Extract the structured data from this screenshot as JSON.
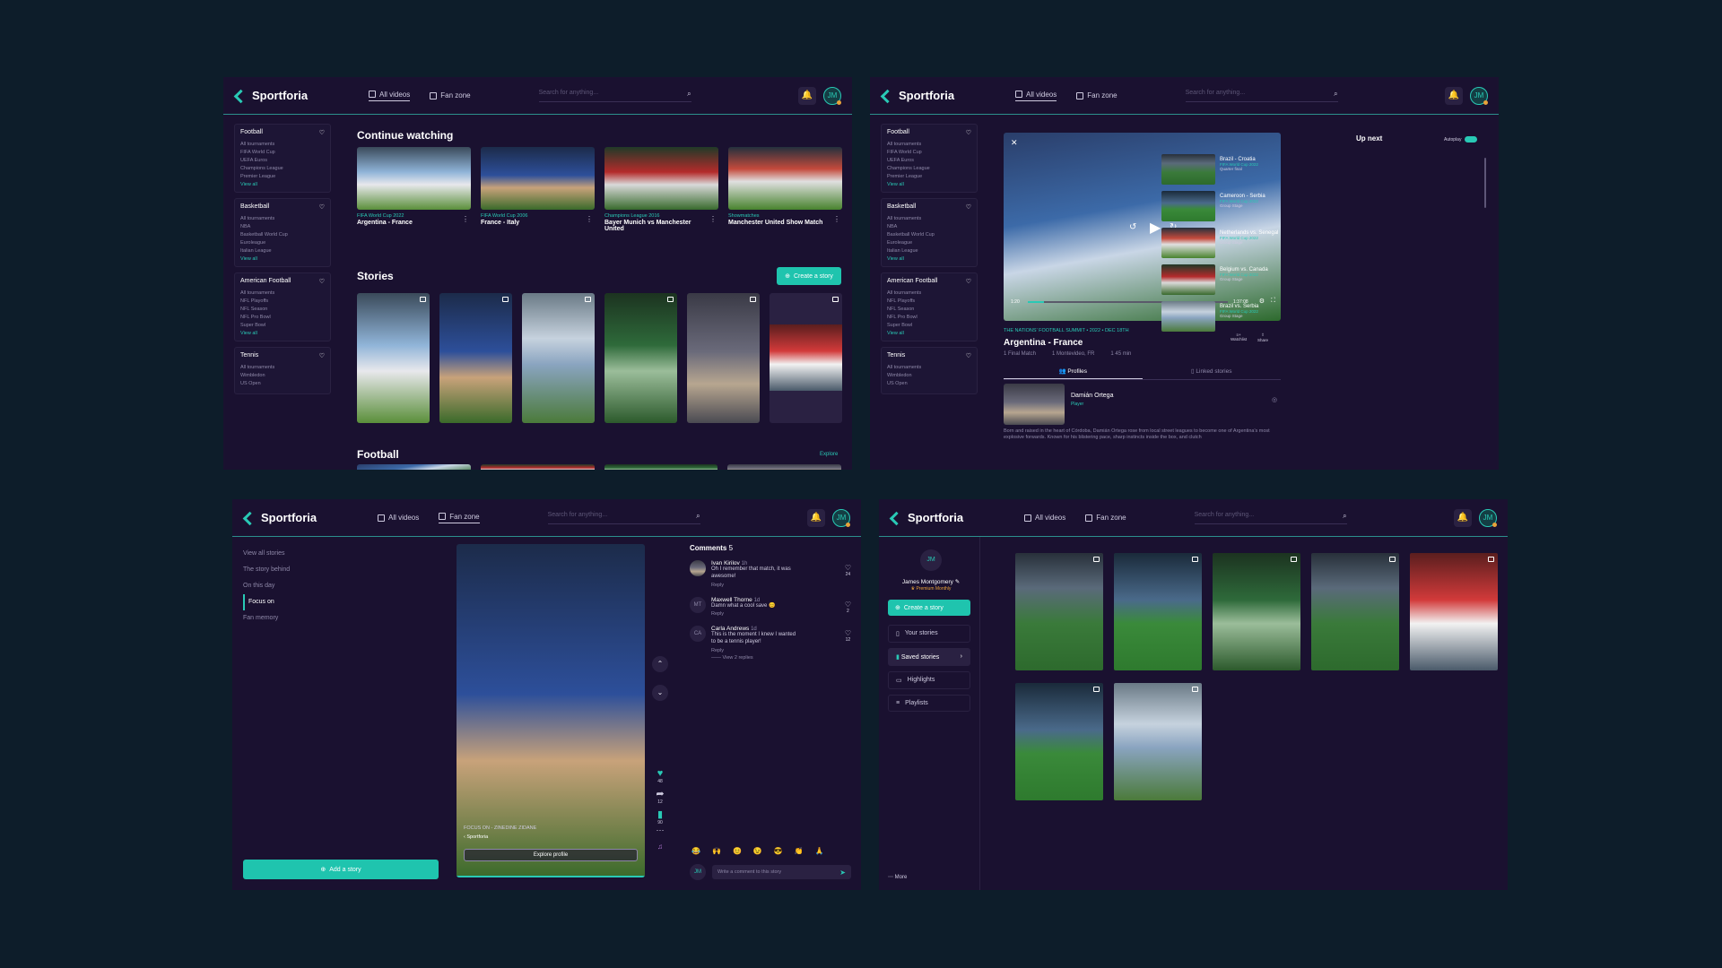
{
  "brand": "Sportforia",
  "nav": {
    "all_videos": "All videos",
    "fan_zone": "Fan zone"
  },
  "search_placeholder": "Search for anything...",
  "user_initials": "JM",
  "sidebar": [
    {
      "title": "Football",
      "items": [
        "All tournaments",
        "FIFA World Cup",
        "UEFA Euros",
        "Champions League",
        "Premier League"
      ]
    },
    {
      "title": "Basketball",
      "items": [
        "All tournaments",
        "NBA",
        "Basketball World Cup",
        "Euroleague",
        "Italian League"
      ]
    },
    {
      "title": "American Football",
      "items": [
        "All tournaments",
        "NFL Playoffs",
        "NFL Season",
        "NFL Pro Bowl",
        "Super Bowl"
      ]
    },
    {
      "title": "Tennis",
      "items": [
        "All tournaments",
        "Wimbledon",
        "US Open"
      ]
    }
  ],
  "view_all": "View all",
  "home": {
    "continue_title": "Continue watching",
    "continue": [
      {
        "tag": "FIFA World Cup 2022",
        "title": "Argentina - France"
      },
      {
        "tag": "FIFA World Cup 2006",
        "title": "France - Italy"
      },
      {
        "tag": "Champions League 2016",
        "title": "Bayer Munich vs Manchester United"
      },
      {
        "tag": "Showmatches",
        "title": "Manchester United Show Match"
      }
    ],
    "stories_title": "Stories",
    "create_story": "Create a story",
    "football_title": "Football",
    "explore": "Explore"
  },
  "player": {
    "current_time": "1:20",
    "total_time": "1:37:08",
    "meta": "THE NATIONS' FOOTBALL SUMMIT  •  2022  •  DEC 18TH",
    "title": "Argentina - France",
    "details": [
      "1 Final Match",
      "1 Montevideo, FR",
      "1 45 min"
    ],
    "watchlist": "Watchlist",
    "share": "Share",
    "tab_profiles": "Profiles",
    "tab_linked": "Linked stories",
    "profile_name": "Damián Ortega",
    "profile_role": "Player",
    "profile_bio": "Born and raised in the heart of Córdoba, Damián Ortega rose from local street leagues to become one of Argentina's most explosive forwards. Known for his blistering pace, sharp instincts inside the box, and clutch",
    "up_next": "Up next",
    "autoplay": "Autoplay",
    "queue": [
      {
        "t": "Brazil - Croatia",
        "s": "FIFA World Cup 2022",
        "st": "Quarter final"
      },
      {
        "t": "Cameroon - Serbia",
        "s": "FIFA World Cup 2022",
        "st": "Group Stage"
      },
      {
        "t": "Netherlands vs. Senegal",
        "s": "FIFA World Cup 2022",
        "st": "Group Stage"
      },
      {
        "t": "Belgium vs. Canada",
        "s": "FIFA World Cup 2022",
        "st": "Group Stage"
      },
      {
        "t": "Brazil vs. Serbia",
        "s": "FIFA World Cup 2022",
        "st": "Group Stage"
      }
    ]
  },
  "story": {
    "menu": [
      "View all stories",
      "The story behind",
      "On this day",
      "Focus on",
      "Fan memory"
    ],
    "add_story": "Add a story",
    "caption": "FOCUS ON  -  ZINEDINE ZIDANE",
    "explore_profile": "Explore profile",
    "likes": "48",
    "shares": "12",
    "saves": "90",
    "comments_title": "Comments",
    "comments_count": "5",
    "comments": [
      {
        "av": "",
        "n": "Ivan Kirilov",
        "time": "1h",
        "t": "Oh I remember that match, it was awesome!",
        "likes": "24"
      },
      {
        "av": "MT",
        "n": "Maxwell Thorne",
        "time": "1d",
        "t": "Damn what a cool save 😊",
        "likes": "2"
      },
      {
        "av": "CA",
        "n": "Carla Andrews",
        "time": "1d",
        "t": "This is the moment I knew I wanted to be a tennis player!",
        "likes": "12"
      }
    ],
    "reply": "Reply",
    "view_replies": "View 2 replies",
    "comment_placeholder": "Write a comment to this story",
    "emojis": [
      "😂",
      "🙌",
      "😊",
      "😉",
      "😎",
      "👏",
      "🙏"
    ]
  },
  "profile": {
    "name": "James Montgomery",
    "plan": "Premium Monthly",
    "create_story": "Create a story",
    "menu": [
      "Your stories",
      "Saved stories",
      "Highlights",
      "Playlists"
    ],
    "more": "More"
  }
}
